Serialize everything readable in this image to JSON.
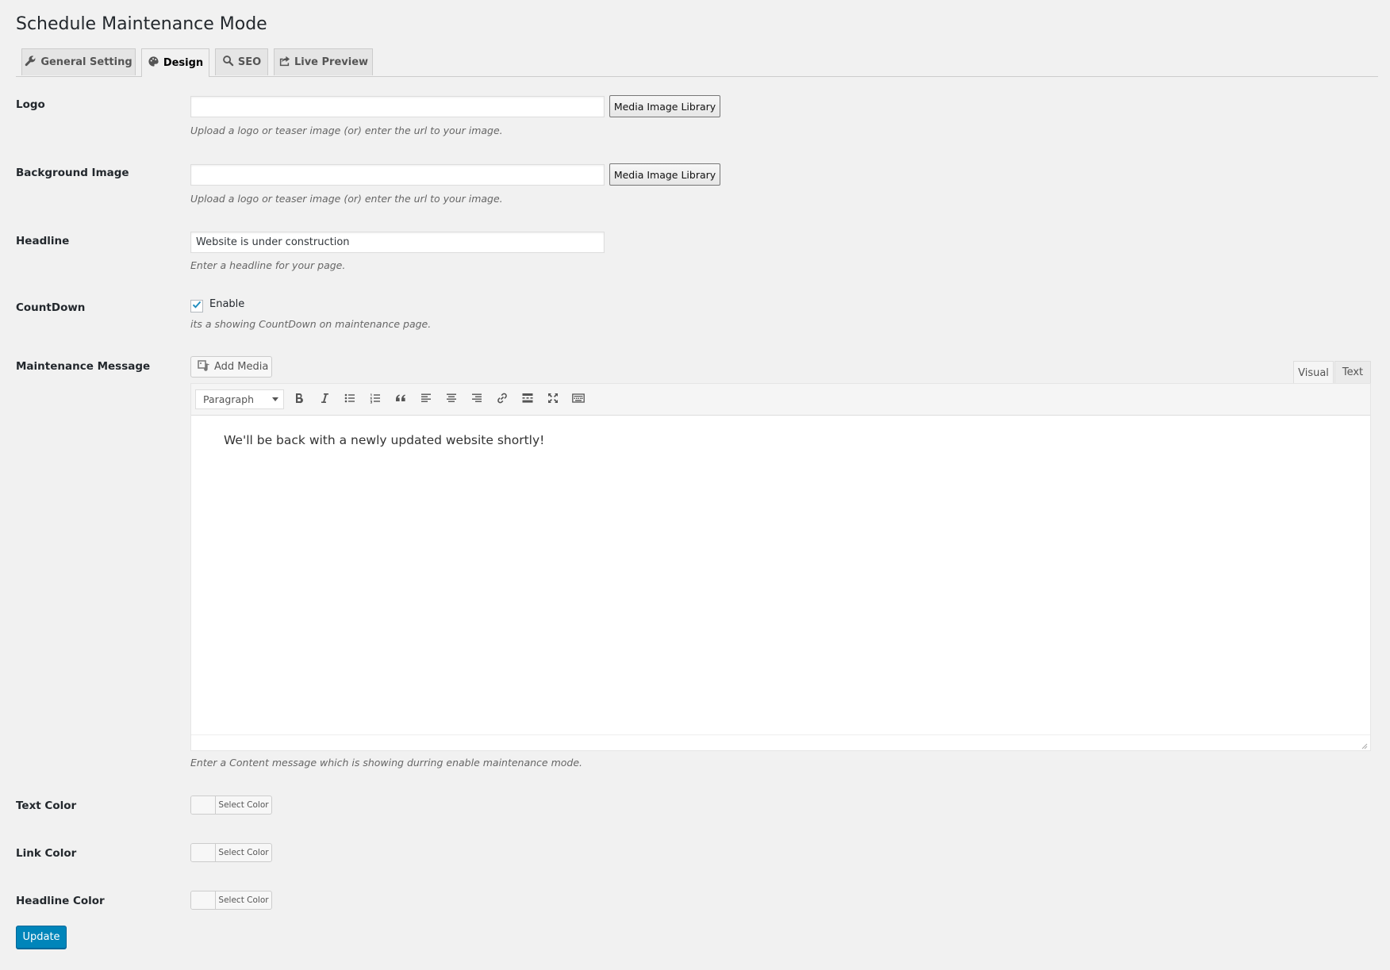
{
  "page": {
    "title": "Schedule Maintenance Mode"
  },
  "tabs": [
    {
      "label": "General Setting",
      "icon": "wrench-icon"
    },
    {
      "label": "Design",
      "icon": "palette-icon",
      "active": true
    },
    {
      "label": "SEO",
      "icon": "search-icon"
    },
    {
      "label": "Live Preview",
      "icon": "share-icon"
    }
  ],
  "fields": {
    "logo": {
      "label": "Logo",
      "value": "",
      "button": "Media Image Library",
      "description": "Upload a logo or teaser image (or) enter the url to your image."
    },
    "background": {
      "label": "Background Image",
      "value": "",
      "button": "Media Image Library",
      "description": "Upload a logo or teaser image (or) enter the url to your image."
    },
    "headline": {
      "label": "Headline",
      "value": "Website is under construction",
      "description": "Enter a headline for your page."
    },
    "countdown": {
      "label": "CountDown",
      "checkbox_label": "Enable",
      "checked": true,
      "description": "its a showing CountDown on maintenance page."
    },
    "message": {
      "label": "Maintenance Message",
      "add_media": "Add Media",
      "tab_visual": "Visual",
      "tab_text": "Text",
      "format": "Paragraph",
      "content": "We'll be back with a newly updated website shortly!",
      "description": "Enter a Content message which is showing durring enable maintenance mode."
    },
    "text_color": {
      "label": "Text Color",
      "button": "Select Color"
    },
    "link_color": {
      "label": "Link Color",
      "button": "Select Color"
    },
    "headline_color": {
      "label": "Headline Color",
      "button": "Select Color"
    }
  },
  "actions": {
    "update": "Update"
  },
  "colors": {
    "primary": "#0085ba",
    "background": "#f1f1f1"
  }
}
